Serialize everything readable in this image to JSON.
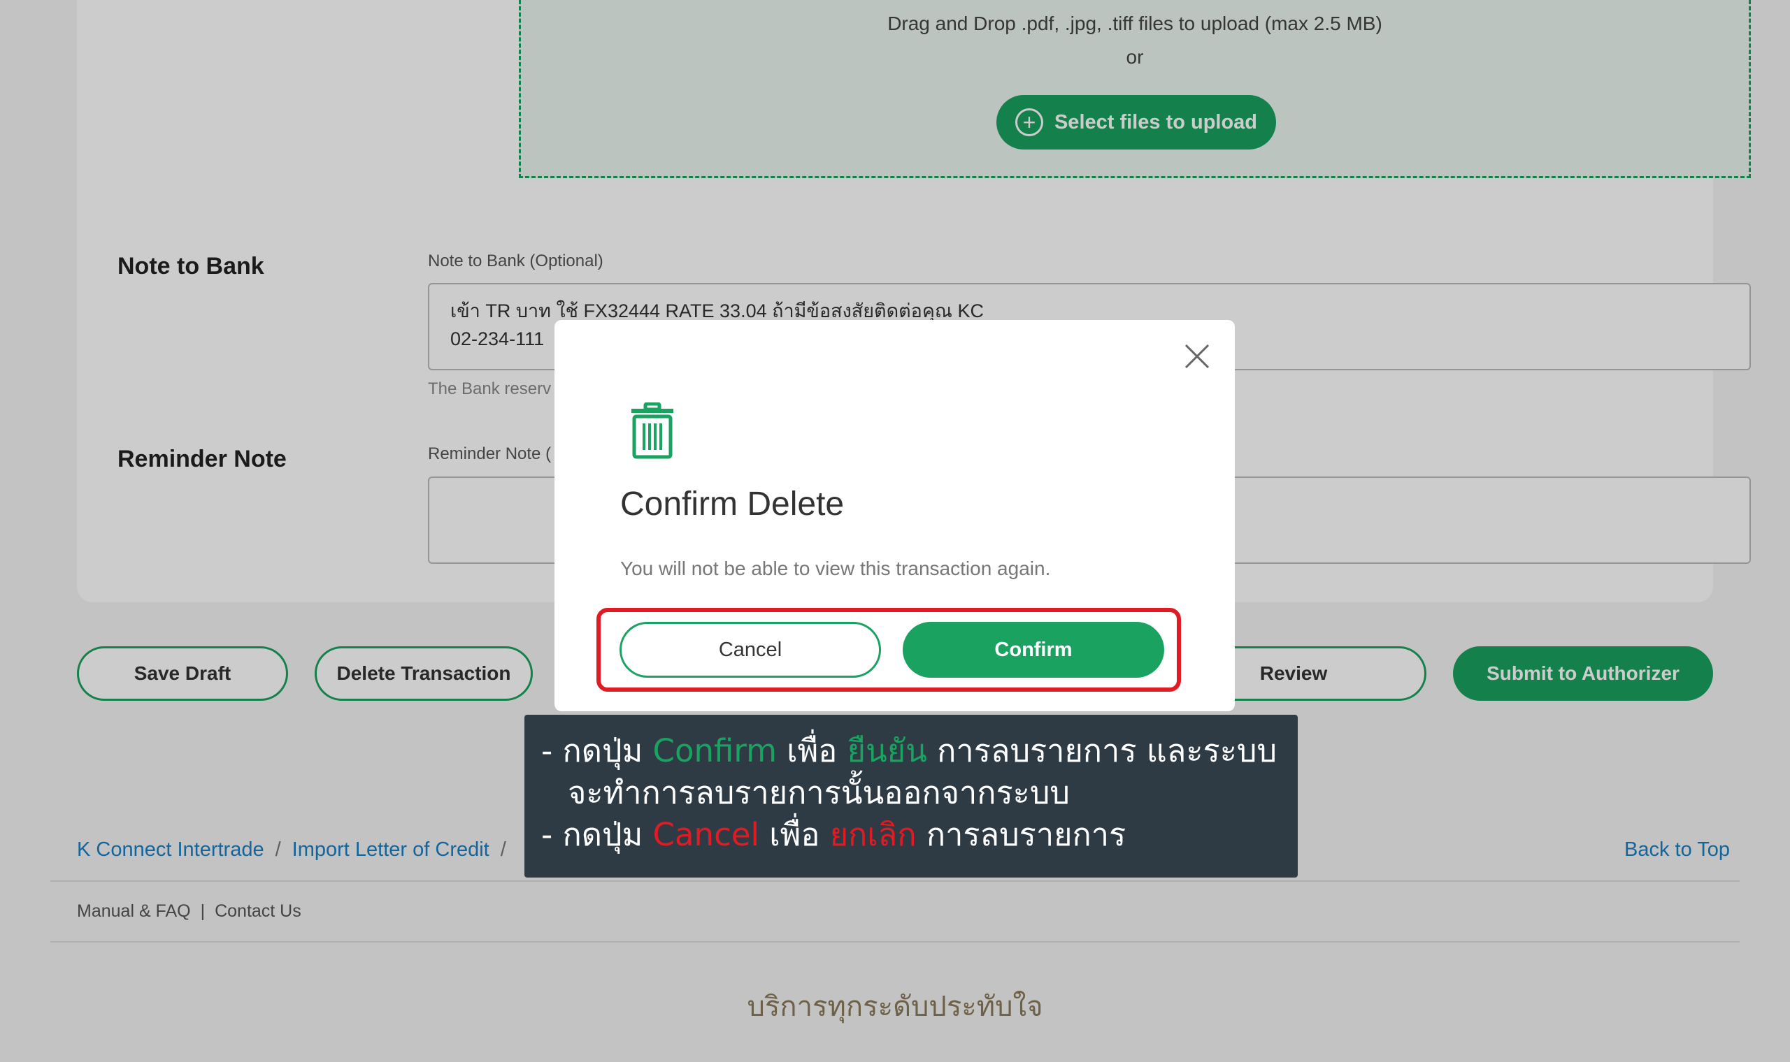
{
  "upload": {
    "instruction": "Drag and Drop .pdf, .jpg, .tiff files to upload (max 2.5 MB)",
    "or": "or",
    "button": "Select files to upload"
  },
  "note_to_bank": {
    "section_title": "Note to Bank",
    "label": "Note to Bank (Optional)",
    "value": "เข้า TR บาท ใช้ FX32444 RATE 33.04 ถ้ามีข้อสงสัยติดต่อคุณ KC\n02-234-111",
    "hint": "The Bank reserv"
  },
  "reminder_note": {
    "section_title": "Reminder Note",
    "label": "Reminder Note (",
    "value": ""
  },
  "actions": {
    "save_draft": "Save Draft",
    "delete_transaction": "Delete Transaction",
    "review": "Review",
    "submit": "Submit to Authorizer"
  },
  "breadcrumb": [
    "K Connect Intertrade",
    "Import Letter of Credit"
  ],
  "breadcrumb_sep": "/",
  "back_to_top": "Back to Top",
  "footer": {
    "manual": "Manual & FAQ",
    "sep": "|",
    "contact": "Contact Us",
    "tagline": "บริการทุกระดับประทับใจ"
  },
  "modal": {
    "title": "Confirm Delete",
    "message": "You will not be able to view this transaction again.",
    "cancel": "Cancel",
    "confirm": "Confirm",
    "icons": [
      "close-icon",
      "trash-icon"
    ]
  },
  "callout": {
    "line1_prefix": "- กดปุ่ม ",
    "line1_btn": "Confirm",
    "line1_mid": " เพื่อ ",
    "line1_action": "ยืนยัน",
    "line1_suffix": " การลบรายการ และระบบ",
    "line2": "จะทำการลบรายการนั้นออกจากระบบ",
    "line3_prefix": "- กดปุ่ม ",
    "line3_btn": "Cancel",
    "line3_mid": " เพื่อ ",
    "line3_action": "ยกเลิก",
    "line3_suffix": " การลบรายการ"
  },
  "colors": {
    "brand_green": "#1aa260",
    "highlight_red": "#e01b24",
    "callout_bg": "#2e3b45",
    "link_blue": "#1a7fc1"
  }
}
